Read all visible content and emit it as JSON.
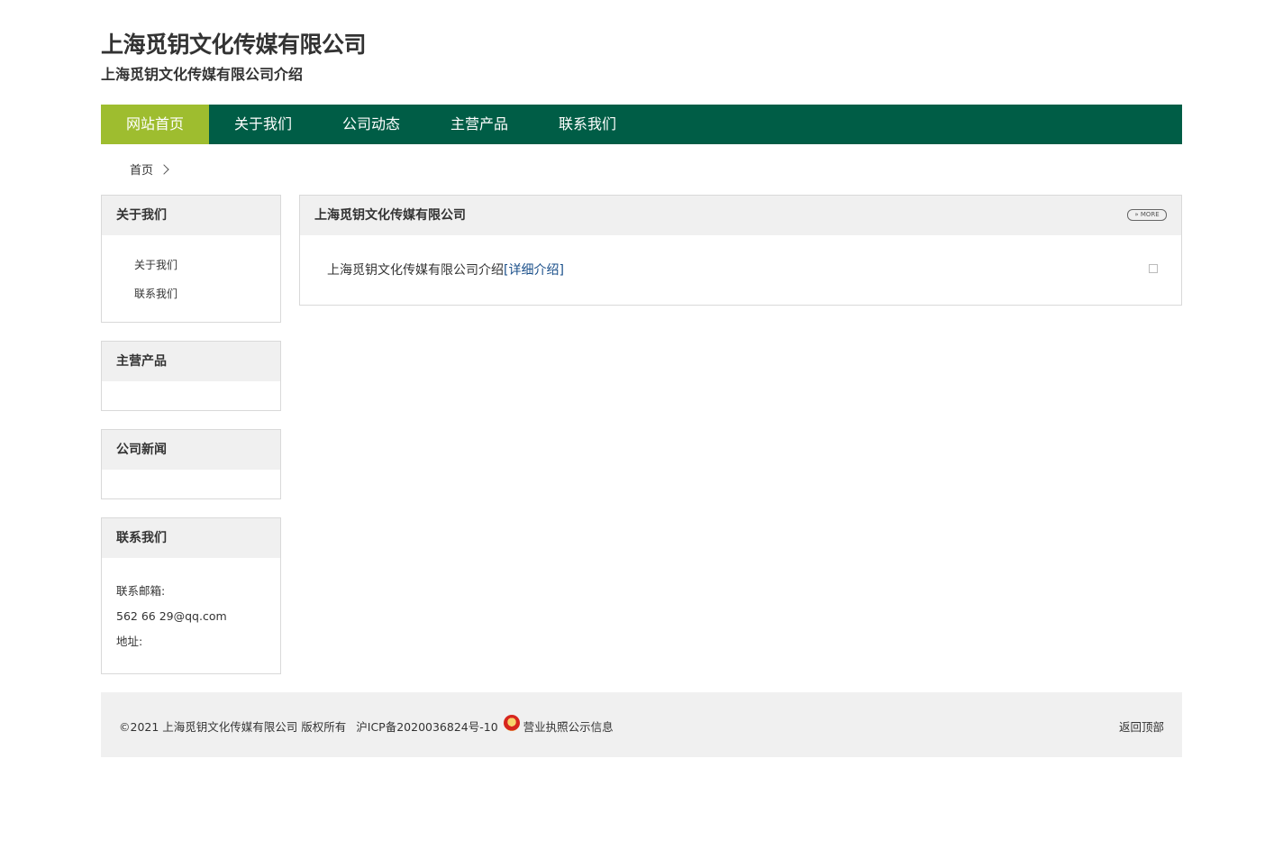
{
  "header": {
    "title": "上海觅钥文化传媒有限公司",
    "subtitle": "上海觅钥文化传媒有限公司介绍"
  },
  "nav": {
    "items": [
      {
        "label": "网站首页",
        "active": true
      },
      {
        "label": "关于我们",
        "active": false
      },
      {
        "label": "公司动态",
        "active": false
      },
      {
        "label": "主营产品",
        "active": false
      },
      {
        "label": "联系我们",
        "active": false
      }
    ]
  },
  "breadcrumb": {
    "home": "首页"
  },
  "sidebar": {
    "about": {
      "title": "关于我们",
      "links": [
        "关于我们",
        "联系我们"
      ]
    },
    "products": {
      "title": "主营产品"
    },
    "news": {
      "title": "公司新闻"
    },
    "contact": {
      "title": "联系我们",
      "email_label": "联系邮箱:",
      "email": "562 66 29@qq.com",
      "address_label": "地址:"
    }
  },
  "main": {
    "title": "上海觅钥文化传媒有限公司",
    "more_label": "» MORE",
    "intro_text": "上海觅钥文化传媒有限公司介绍",
    "detail_link": "[详细介绍]"
  },
  "footer": {
    "copyright": "©2021 上海觅钥文化传媒有限公司 版权所有",
    "icp": "沪ICP备2020036824号-10",
    "license": "营业执照公示信息",
    "back_to_top": "返回顶部"
  },
  "colors": {
    "nav_bg": "#005d46",
    "nav_active": "#9ebd2f",
    "panel_head": "#f0f0f0",
    "link": "#1a4f8a"
  }
}
